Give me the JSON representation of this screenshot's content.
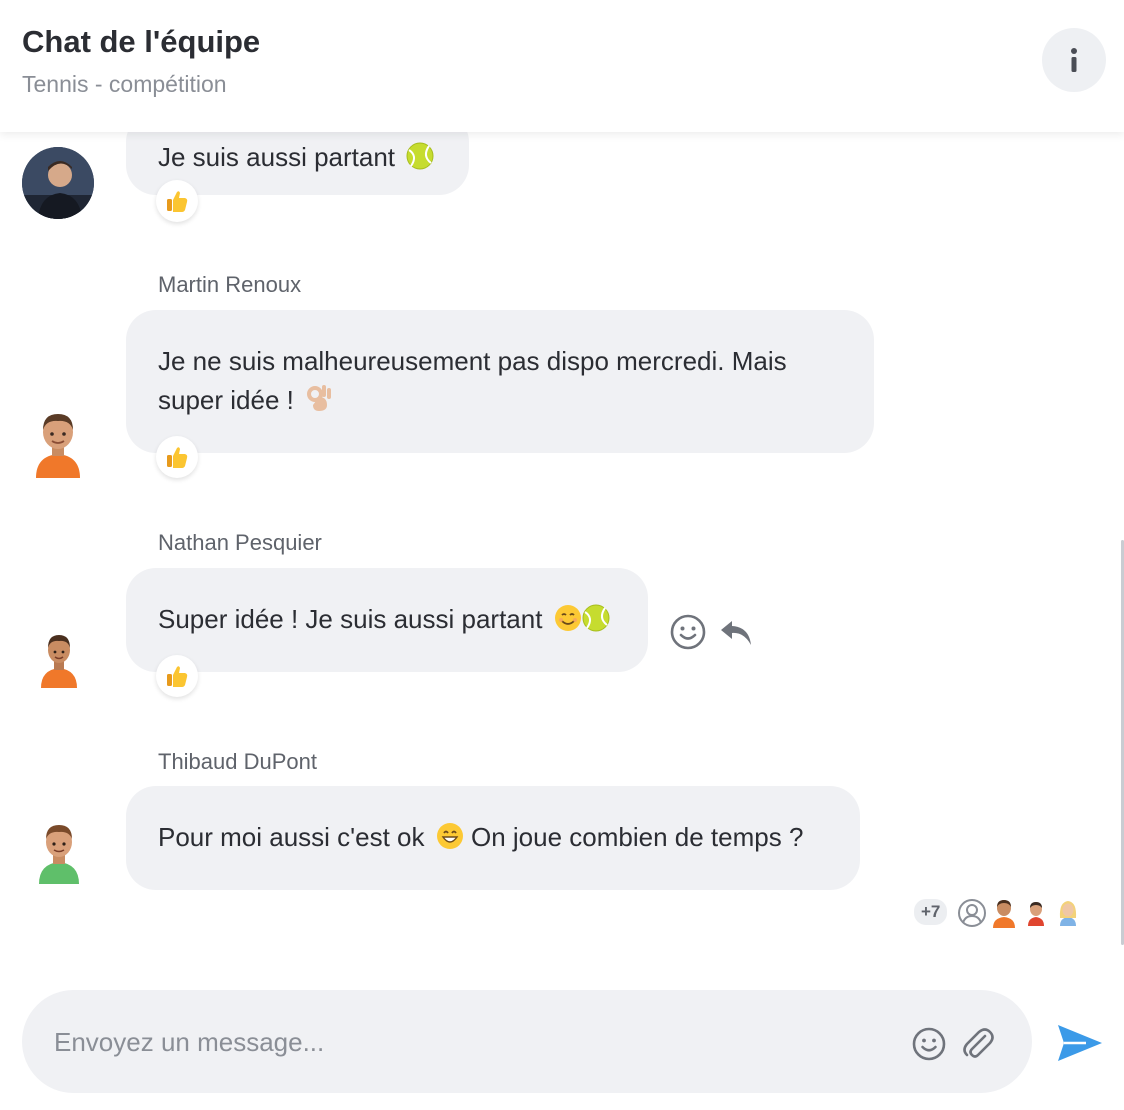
{
  "header": {
    "title": "Chat de l'équipe",
    "subtitle": "Tennis - compétition",
    "info_label": "i"
  },
  "messages": [
    {
      "sender": "",
      "text": "Je suis aussi partant",
      "emojis": [
        "tennis-ball-emoji"
      ],
      "reaction": "thumbs-up"
    },
    {
      "sender": "Martin Renoux",
      "text_line1": "Je ne suis malheureusement pas dispo mercredi. Mais",
      "text_line2": "super idée !",
      "emojis": [
        "ok-hand-emoji"
      ],
      "reaction": "thumbs-up"
    },
    {
      "sender": "Nathan Pesquier",
      "text": "Super idée ! Je suis aussi partant",
      "emojis": [
        "smiling-face-emoji",
        "tennis-ball-emoji"
      ],
      "reaction": "thumbs-up"
    },
    {
      "sender": "Thibaud DuPont",
      "text": "Pour moi aussi c'est ok",
      "text_after": "On joue combien de temps ?",
      "emojis": [
        "grinning-face-emoji"
      ]
    }
  ],
  "seen_by": {
    "extra_count": "+7",
    "avatars": [
      "generic-user-icon",
      "avatar-orange",
      "avatar-red",
      "avatar-blonde"
    ]
  },
  "composer": {
    "placeholder": "Envoyez un message..."
  },
  "colors": {
    "bubble": "#f0f1f4",
    "accent": "#3b9ae8",
    "orange_shirt": "#f0782a",
    "green_shirt": "#5fbf6a"
  }
}
